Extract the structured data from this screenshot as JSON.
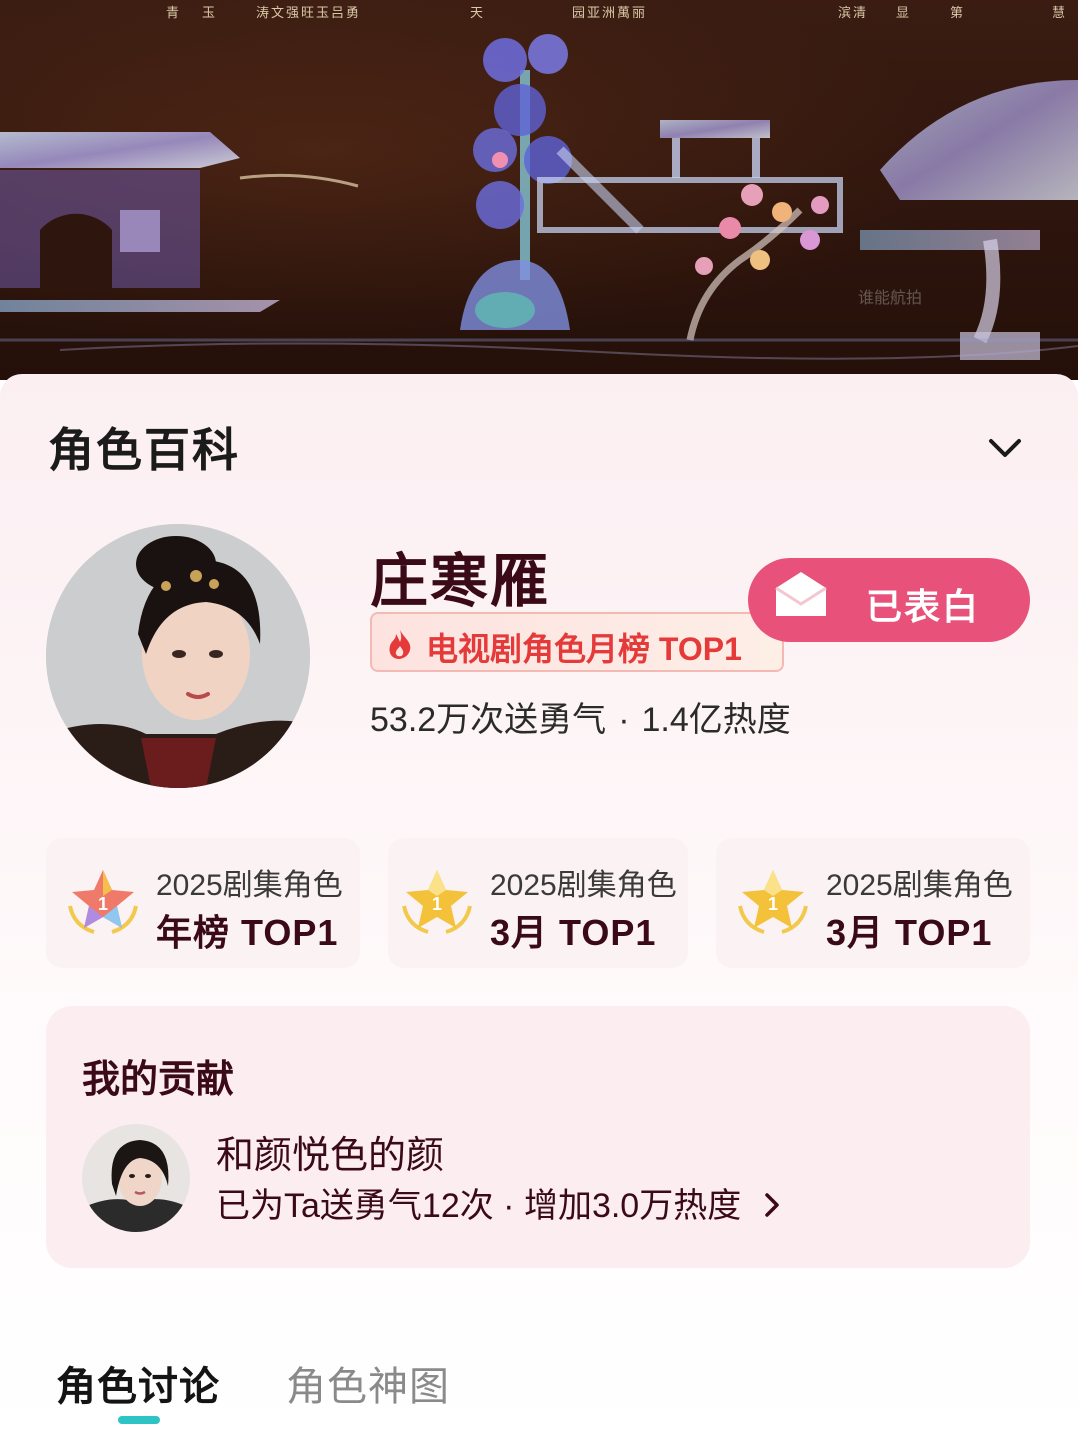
{
  "banner": {
    "captions": [
      "青",
      "玉",
      "涛文强旺玉吕勇",
      "天",
      "园亚洲萬丽",
      "滨清",
      "显",
      "第",
      "慧"
    ],
    "watermark": "谁能航拍"
  },
  "card": {
    "section_title": "角色百科",
    "collapse_icon": "chevron-down-icon"
  },
  "character": {
    "name": "庄寒雁",
    "rank_tag": "电视剧角色月榜 TOP1",
    "confess_label": "已表白",
    "stats": {
      "courage": "53.2万次送勇气",
      "separator": "·",
      "heat": "1.4亿热度"
    }
  },
  "badges": [
    {
      "title": "2025剧集角色",
      "rank": "年榜 TOP1",
      "medal": "medal-rainbow-icon",
      "medal_number": "1"
    },
    {
      "title": "2025剧集角色",
      "rank": "3月 TOP1",
      "medal": "medal-gold-icon",
      "medal_number": "1"
    },
    {
      "title": "2025剧集角色",
      "rank": "3月 TOP1",
      "medal": "medal-gold-icon",
      "medal_number": "1"
    }
  ],
  "contribution": {
    "title": "我的贡献",
    "user_name": "和颜悦色的颜",
    "detail": "已为Ta送勇气12次 · 增加3.0万热度"
  },
  "tabs": [
    {
      "label": "角色讨论",
      "active": true
    },
    {
      "label": "角色神图",
      "active": false
    }
  ],
  "colors": {
    "accent_pink": "#e8527a",
    "name_dark": "#3a0b16",
    "rank_red": "#e43a3a",
    "tab_indicator": "#2ec4c6"
  }
}
